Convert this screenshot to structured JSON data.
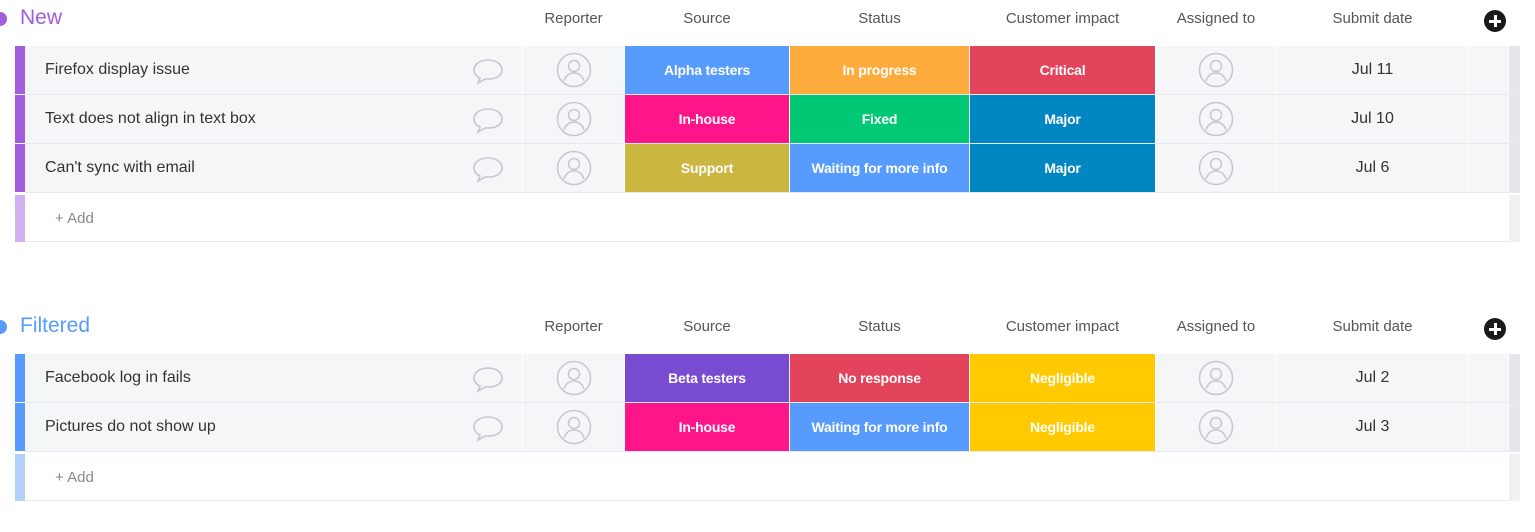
{
  "columns": {
    "reporter": "Reporter",
    "source": "Source",
    "status": "Status",
    "impact": "Customer impact",
    "assigned": "Assigned to",
    "date": "Submit date"
  },
  "add_row_label": "+ Add",
  "groups": [
    {
      "title": "New",
      "color": "#a25ddc",
      "title_color": "#a25ddc",
      "add_bar_color": "#d0b0f0",
      "rows": [
        {
          "name": "Firefox display issue",
          "source": {
            "label": "Alpha testers",
            "color": "#579bfc"
          },
          "status": {
            "label": "In progress",
            "color": "#fdab3d"
          },
          "impact": {
            "label": "Critical",
            "color": "#e2445c"
          },
          "date": "Jul 11"
        },
        {
          "name": "Text does not align in text box",
          "source": {
            "label": "In-house",
            "color": "#ff158a"
          },
          "status": {
            "label": "Fixed",
            "color": "#00c875"
          },
          "impact": {
            "label": "Major",
            "color": "#0086c0"
          },
          "date": "Jul 10"
        },
        {
          "name": "Can't sync with email",
          "source": {
            "label": "Support",
            "color": "#cab641"
          },
          "status": {
            "label": "Waiting for more info",
            "color": "#579bfc"
          },
          "impact": {
            "label": "Major",
            "color": "#0086c0"
          },
          "date": "Jul 6"
        }
      ]
    },
    {
      "title": "Filtered",
      "color": "#579bfc",
      "title_color": "#579bfc",
      "add_bar_color": "#b3d1fd",
      "rows": [
        {
          "name": "Facebook log in fails",
          "source": {
            "label": "Beta testers",
            "color": "#784bd1"
          },
          "status": {
            "label": "No response",
            "color": "#e2445c"
          },
          "impact": {
            "label": "Negligible",
            "color": "#ffcb00"
          },
          "date": "Jul 2"
        },
        {
          "name": "Pictures do not show up",
          "source": {
            "label": "In-house",
            "color": "#ff158a"
          },
          "status": {
            "label": "Waiting for more info",
            "color": "#579bfc"
          },
          "impact": {
            "label": "Negligible",
            "color": "#ffcb00"
          },
          "date": "Jul 3"
        }
      ]
    }
  ]
}
